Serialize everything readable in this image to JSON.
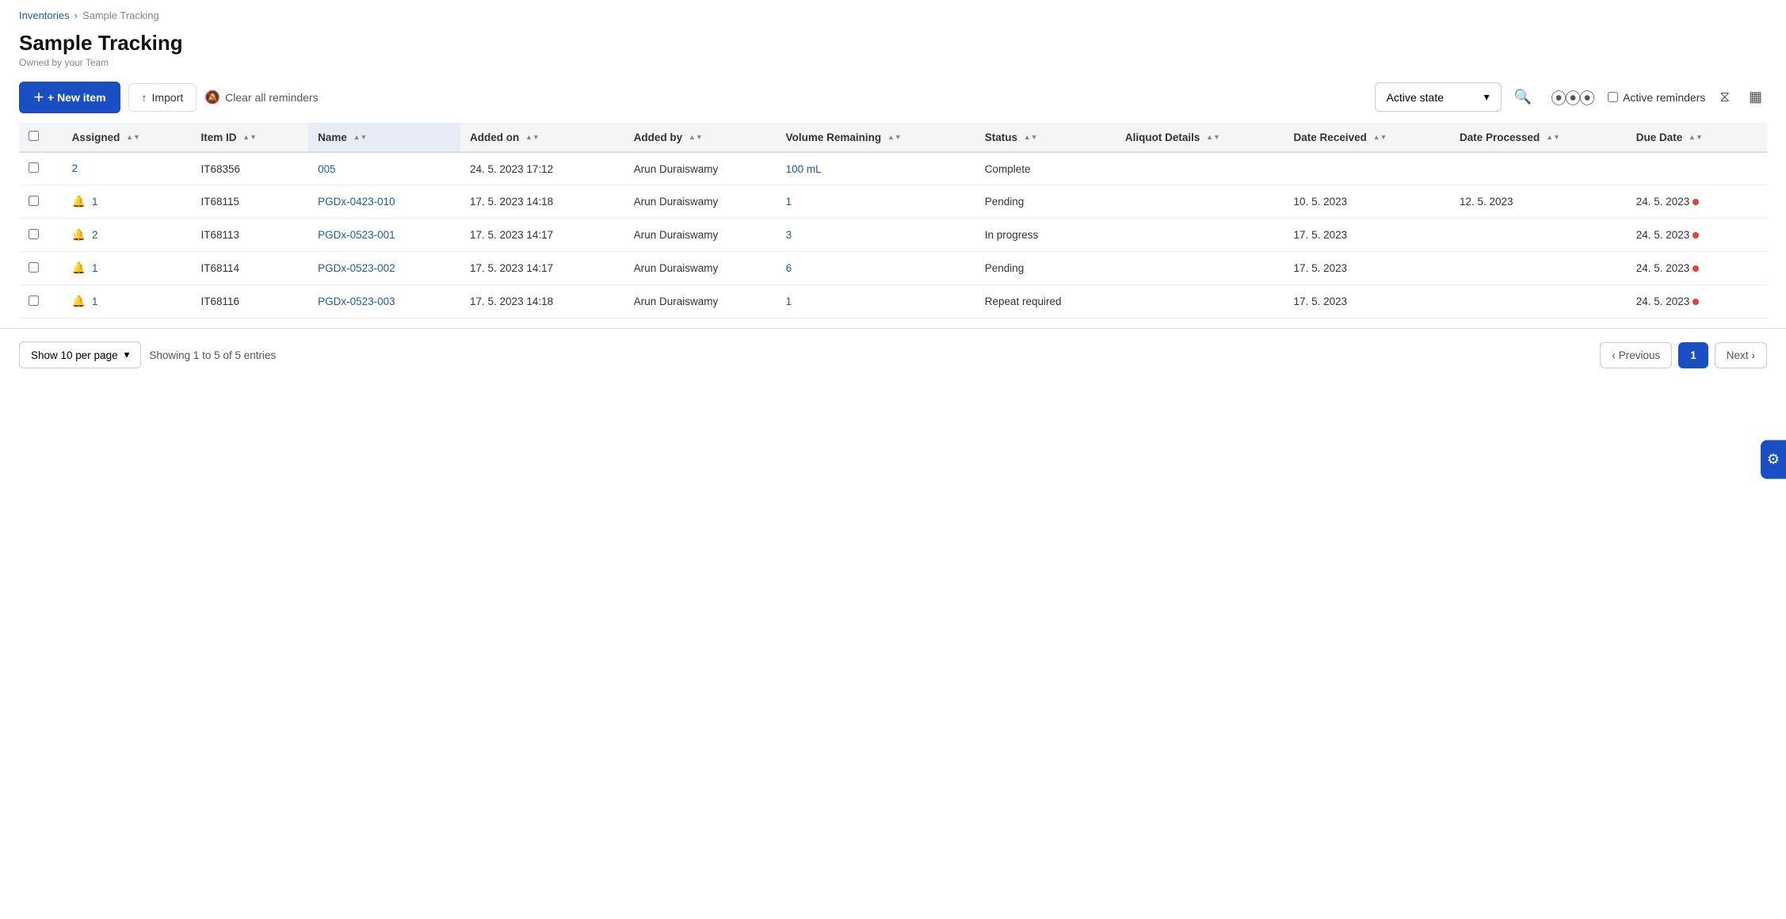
{
  "breadcrumb": {
    "parent": "Inventories",
    "current": "Sample Tracking",
    "separator": "›"
  },
  "page": {
    "title": "Sample Tracking",
    "subtitle": "Owned by your Team"
  },
  "toolbar": {
    "new_item_label": "+ New item",
    "import_label": "Import",
    "clear_reminders_label": "Clear all reminders",
    "active_state_label": "Active state",
    "active_reminders_label": "Active reminders",
    "search_icon": "🔍",
    "barcode_icon": "|||",
    "filter_icon": "⧖",
    "chart_icon": "▦",
    "chevron_down": "▾"
  },
  "table": {
    "columns": [
      {
        "key": "assigned",
        "label": "Assigned",
        "sortable": true,
        "sorted": false
      },
      {
        "key": "item_id",
        "label": "Item ID",
        "sortable": true,
        "sorted": false
      },
      {
        "key": "name",
        "label": "Name",
        "sortable": true,
        "sorted": true
      },
      {
        "key": "added_on",
        "label": "Added on",
        "sortable": true,
        "sorted": false
      },
      {
        "key": "added_by",
        "label": "Added by",
        "sortable": true,
        "sorted": false
      },
      {
        "key": "volume_remaining",
        "label": "Volume Remaining",
        "sortable": true,
        "sorted": false
      },
      {
        "key": "status",
        "label": "Status",
        "sortable": true,
        "sorted": false
      },
      {
        "key": "aliquot_details",
        "label": "Aliquot Details",
        "sortable": true,
        "sorted": false
      },
      {
        "key": "date_received",
        "label": "Date Received",
        "sortable": true,
        "sorted": false
      },
      {
        "key": "date_processed",
        "label": "Date Processed",
        "sortable": true,
        "sorted": false
      },
      {
        "key": "due_date",
        "label": "Due Date",
        "sortable": true,
        "sorted": false
      }
    ],
    "rows": [
      {
        "checkbox": false,
        "bell": false,
        "assigned": "2",
        "item_id": "IT68356",
        "name": "005",
        "added_on": "24. 5. 2023 17:12",
        "added_by": "Arun Duraiswamy",
        "volume_remaining": "100 mL",
        "status": "Complete",
        "aliquot_details": "",
        "date_received": "",
        "date_processed": "",
        "due_date": "",
        "due_date_dot": false
      },
      {
        "checkbox": false,
        "bell": true,
        "assigned": "1",
        "item_id": "IT68115",
        "name": "PGDx-0423-010",
        "added_on": "17. 5. 2023 14:18",
        "added_by": "Arun Duraiswamy",
        "volume_remaining": "1",
        "status": "Pending",
        "aliquot_details": "",
        "date_received": "10. 5. 2023",
        "date_processed": "12. 5. 2023",
        "due_date": "24. 5. 2023",
        "due_date_dot": true
      },
      {
        "checkbox": false,
        "bell": true,
        "assigned": "2",
        "item_id": "IT68113",
        "name": "PGDx-0523-001",
        "added_on": "17. 5. 2023 14:17",
        "added_by": "Arun Duraiswamy",
        "volume_remaining": "3",
        "status": "In progress",
        "aliquot_details": "",
        "date_received": "17. 5. 2023",
        "date_processed": "",
        "due_date": "24. 5. 2023",
        "due_date_dot": true
      },
      {
        "checkbox": false,
        "bell": true,
        "assigned": "1",
        "item_id": "IT68114",
        "name": "PGDx-0523-002",
        "added_on": "17. 5. 2023 14:17",
        "added_by": "Arun Duraiswamy",
        "volume_remaining": "6",
        "status": "Pending",
        "aliquot_details": "",
        "date_received": "17. 5. 2023",
        "date_processed": "",
        "due_date": "24. 5. 2023",
        "due_date_dot": true
      },
      {
        "checkbox": false,
        "bell": true,
        "assigned": "1",
        "item_id": "IT68116",
        "name": "PGDx-0523-003",
        "added_on": "17. 5. 2023 14:18",
        "added_by": "Arun Duraiswamy",
        "volume_remaining": "1",
        "status": "Repeat required",
        "aliquot_details": "",
        "date_received": "17. 5. 2023",
        "date_processed": "",
        "due_date": "24. 5. 2023",
        "due_date_dot": true
      }
    ]
  },
  "footer": {
    "per_page_label": "Show 10 per page",
    "showing_text": "Showing 1 to 5 of 5 entries",
    "previous_label": "Previous",
    "next_label": "Next",
    "current_page": "1",
    "chevron_left": "‹",
    "chevron_right": "›"
  },
  "support": {
    "label": "⚙",
    "icon": "⚙"
  }
}
